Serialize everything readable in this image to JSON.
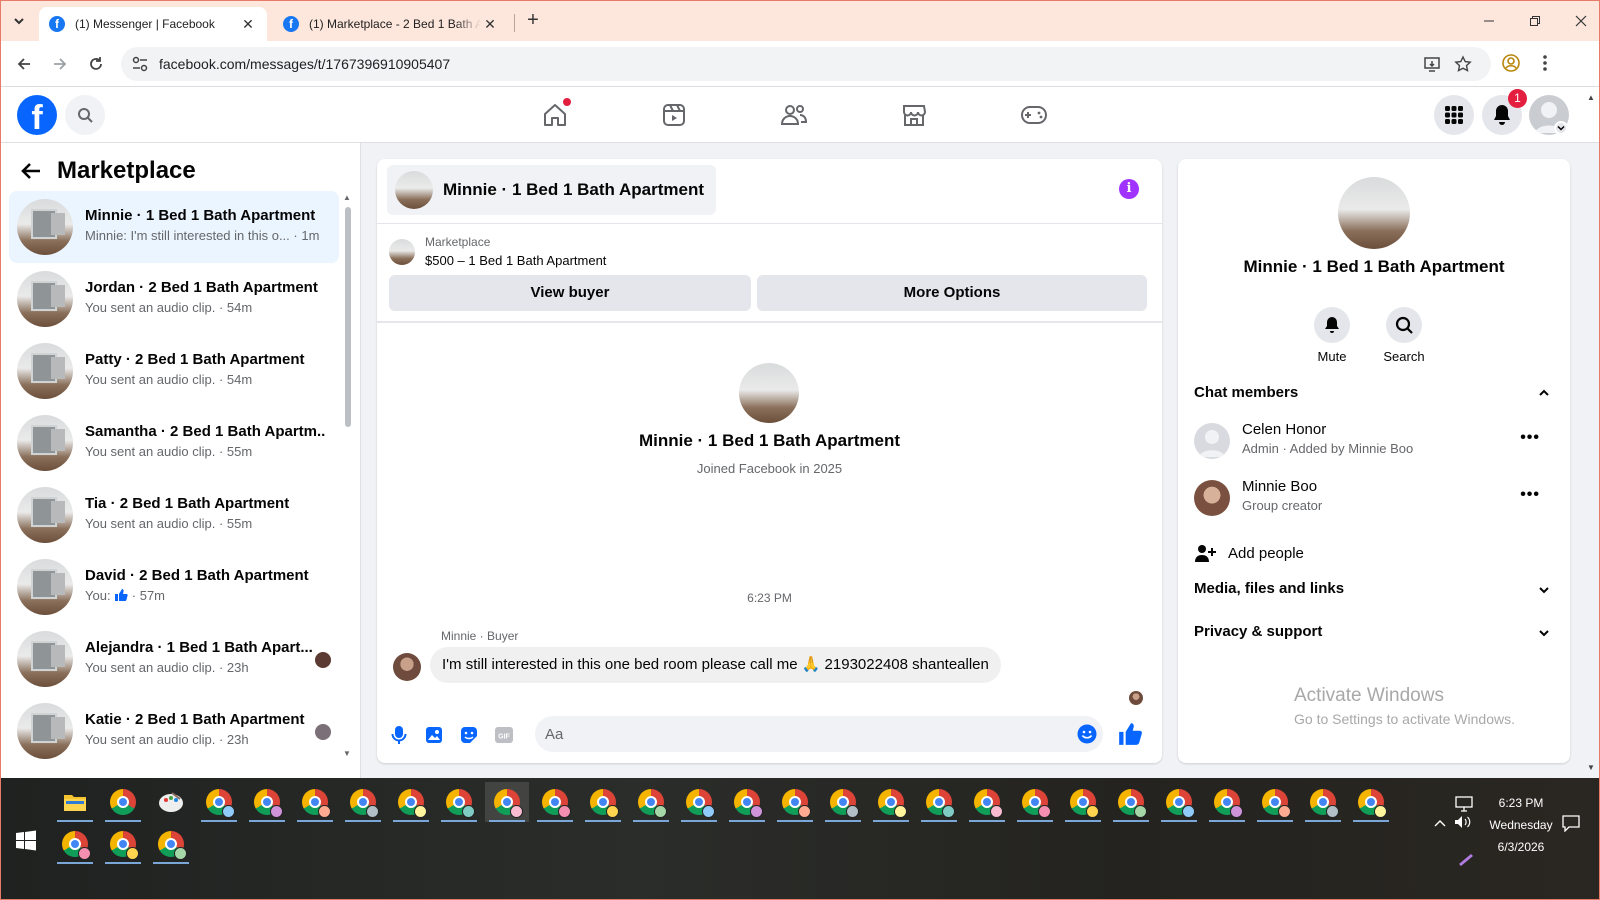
{
  "browser": {
    "tabs": [
      {
        "title": "(1) Messenger | Facebook",
        "active": true
      },
      {
        "title": "(1) Marketplace - 2 Bed 1 Bath Apartment",
        "active": false
      }
    ],
    "close_symbol": "✕",
    "new_tab_symbol": "+",
    "url": "facebook.com/messages/t/1767396910905407"
  },
  "header": {
    "logo_letter": "f",
    "notification_count": "1",
    "accent": "#0866ff"
  },
  "left_panel": {
    "title": "Marketplace",
    "conversations": [
      {
        "name": "Minnie · 1 Bed 1 Bath Apartment",
        "snippet": "Minnie: I'm still interested in this o...",
        "time": " · 1m",
        "active": true
      },
      {
        "name": "Jordan · 2 Bed 1 Bath Apartment",
        "snippet": "You sent an audio clip.",
        "time": " · 54m"
      },
      {
        "name": "Patty · 2 Bed 1 Bath Apartment",
        "snippet": "You sent an audio clip.",
        "time": " · 54m"
      },
      {
        "name": "Samantha · 2 Bed 1 Bath Apartm...",
        "snippet": "You sent an audio clip.",
        "time": " · 55m"
      },
      {
        "name": "Tia · 2 Bed 1 Bath Apartment",
        "snippet": "You sent an audio clip.",
        "time": " · 55m"
      },
      {
        "name": "David · 2 Bed 1 Bath Apartment",
        "snippet": "You: ",
        "time": " · 57m"
      },
      {
        "name": "Alejandra · 1 Bed 1 Bath Apart...",
        "snippet": "You sent an audio clip.",
        "time": " · 23h"
      },
      {
        "name": "Katie · 2 Bed 1 Bath Apartment",
        "snippet": "You sent an audio clip.",
        "time": " · 23h"
      }
    ]
  },
  "chat": {
    "title": "Minnie · 1 Bed 1 Bath Apartment",
    "info_letter": "i",
    "listing_label": "Marketplace",
    "listing_price": "$500 – 1 Bed 1 Bath Apartment",
    "view_buyer": "View buyer",
    "more_options": "More Options",
    "intro_name": "Minnie · 1 Bed 1 Bath Apartment",
    "intro_sub": "Joined Facebook in 2025",
    "timestamp": "6:23 PM",
    "sender": "Minnie · Buyer",
    "message": "I'm still interested in this one bed room please call me 🙏 2193022408 shanteallen",
    "composer_placeholder": "Aa",
    "gif_label": "GIF"
  },
  "right_panel": {
    "name": "Minnie · 1 Bed 1 Bath Apartment",
    "mute": "Mute",
    "search": "Search",
    "chat_members": "Chat members",
    "members": [
      {
        "name": "Celen Honor",
        "role": "Admin · Added by Minnie Boo"
      },
      {
        "name": "Minnie Boo",
        "role": "Group creator"
      }
    ],
    "more_symbol": "•••",
    "add_people": "Add people",
    "media": "Media, files and links",
    "privacy": "Privacy & support",
    "activate_title": "Activate Windows",
    "activate_sub": "Go to Settings to activate Windows."
  },
  "taskbar": {
    "time": "6:23 PM",
    "day": "Wednesday",
    "date": "6/3/2026"
  }
}
